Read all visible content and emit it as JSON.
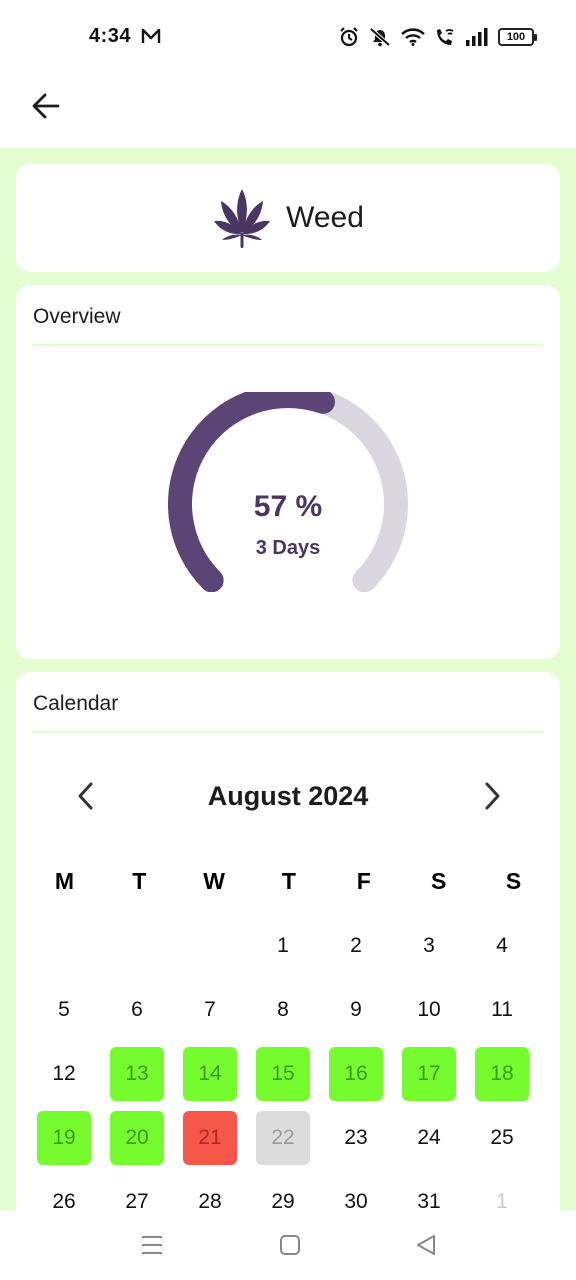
{
  "status_bar": {
    "time": "4:34",
    "battery": "100",
    "icons": [
      "mail-icon",
      "alarm-icon",
      "mute-icon",
      "wifi-icon",
      "wifi-call-icon",
      "signal-icon",
      "battery-icon"
    ]
  },
  "app_bar": {
    "back_icon": "arrow-left-icon"
  },
  "habit": {
    "title": "Weed",
    "icon": "cannabis-leaf-icon",
    "accent_color": "#4a3563"
  },
  "overview": {
    "header": "Overview",
    "progress_percent": 57,
    "percent_label": "57 %",
    "days_label": "3 Days",
    "gauge_track_color": "#dad7e0",
    "gauge_fill_color": "#5c4477"
  },
  "calendar": {
    "header": "Calendar",
    "month_title": "August 2024",
    "prev_icon": "chevron-left-icon",
    "next_icon": "chevron-right-icon",
    "weekdays": [
      "M",
      "T",
      "W",
      "T",
      "F",
      "S",
      "S"
    ],
    "status_colors": {
      "clean": "#76fb2f",
      "relapse": "#f7564a",
      "today": "#dcdcdc"
    },
    "days": [
      {
        "label": "",
        "state": "empty"
      },
      {
        "label": "",
        "state": "empty"
      },
      {
        "label": "",
        "state": "empty"
      },
      {
        "label": "1",
        "state": "normal"
      },
      {
        "label": "2",
        "state": "normal"
      },
      {
        "label": "3",
        "state": "normal"
      },
      {
        "label": "4",
        "state": "normal"
      },
      {
        "label": "5",
        "state": "normal"
      },
      {
        "label": "6",
        "state": "normal"
      },
      {
        "label": "7",
        "state": "normal"
      },
      {
        "label": "8",
        "state": "normal"
      },
      {
        "label": "9",
        "state": "normal"
      },
      {
        "label": "10",
        "state": "normal"
      },
      {
        "label": "11",
        "state": "normal"
      },
      {
        "label": "12",
        "state": "normal"
      },
      {
        "label": "13",
        "state": "clean"
      },
      {
        "label": "14",
        "state": "clean"
      },
      {
        "label": "15",
        "state": "clean"
      },
      {
        "label": "16",
        "state": "clean"
      },
      {
        "label": "17",
        "state": "clean"
      },
      {
        "label": "18",
        "state": "clean"
      },
      {
        "label": "19",
        "state": "clean"
      },
      {
        "label": "20",
        "state": "clean"
      },
      {
        "label": "21",
        "state": "relapse"
      },
      {
        "label": "22",
        "state": "today"
      },
      {
        "label": "23",
        "state": "normal"
      },
      {
        "label": "24",
        "state": "normal"
      },
      {
        "label": "25",
        "state": "normal"
      },
      {
        "label": "26",
        "state": "normal"
      },
      {
        "label": "27",
        "state": "normal"
      },
      {
        "label": "28",
        "state": "normal"
      },
      {
        "label": "29",
        "state": "normal"
      },
      {
        "label": "30",
        "state": "normal"
      },
      {
        "label": "31",
        "state": "normal"
      },
      {
        "label": "1",
        "state": "other-month"
      }
    ]
  },
  "nav_bar": {
    "icons": [
      "menu-icon",
      "home-icon",
      "back-icon"
    ]
  }
}
